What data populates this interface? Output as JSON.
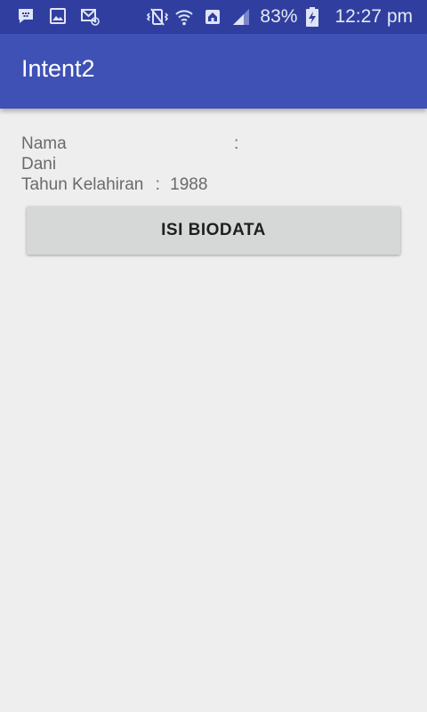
{
  "status_bar": {
    "battery": "83%",
    "time": "12:27 pm",
    "icons_left": [
      "bbm-icon",
      "gallery-icon",
      "email-icon"
    ],
    "icons_right": [
      "vibrate-icon",
      "wifi-icon",
      "home-signal-icon",
      "signal-icon",
      "battery-charging-icon"
    ]
  },
  "app_bar": {
    "title": "Intent2"
  },
  "form": {
    "nama_label": "Nama",
    "nama_colon": ":",
    "nama_value": "Dani",
    "tahun_label": "Tahun Kelahiran",
    "tahun_colon": ":",
    "tahun_value": "1988"
  },
  "button": {
    "label": "ISI BIODATA"
  },
  "colors": {
    "status_bar": "#303f9f",
    "app_bar": "#3f51b5",
    "background": "#eeeeee",
    "text": "#6a6a6a",
    "button": "#d6d7d7"
  }
}
